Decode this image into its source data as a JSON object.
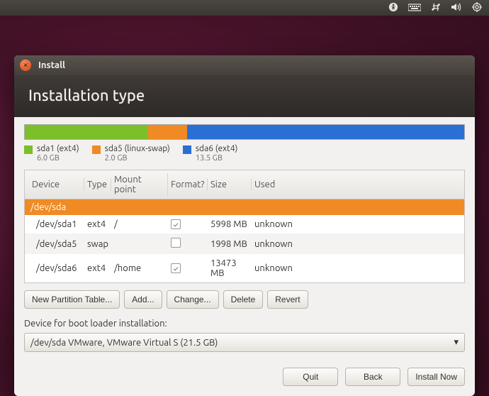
{
  "top_panel": {
    "icons": [
      "accessibility",
      "keyboard",
      "network",
      "sound",
      "power"
    ]
  },
  "window": {
    "title": "Install",
    "heading": "Installation type"
  },
  "partitions": {
    "legend": [
      {
        "label": "sda1 (ext4)",
        "size": "6.0 GB",
        "color": "#7bbf2a"
      },
      {
        "label": "sda5 (linux-swap)",
        "size": "2.0 GB",
        "color": "#f08a24"
      },
      {
        "label": "sda6 (ext4)",
        "size": "13.5 GB",
        "color": "#2a6fd4"
      }
    ],
    "segments_pct": [
      28,
      9,
      63
    ]
  },
  "table": {
    "headers": [
      "Device",
      "Type",
      "Mount point",
      "Format?",
      "Size",
      "Used"
    ],
    "disk_row": "/dev/sda",
    "rows": [
      {
        "device": "/dev/sda1",
        "type": "ext4",
        "mount": "/",
        "format": true,
        "size": "5998 MB",
        "used": "unknown"
      },
      {
        "device": "/dev/sda5",
        "type": "swap",
        "mount": "",
        "format": false,
        "size": "1998 MB",
        "used": "unknown"
      },
      {
        "device": "/dev/sda6",
        "type": "ext4",
        "mount": "/home",
        "format": true,
        "size": "13473 MB",
        "used": "unknown"
      }
    ]
  },
  "part_buttons": {
    "new_table": "New Partition Table...",
    "add": "Add...",
    "change": "Change...",
    "delete": "Delete",
    "revert": "Revert"
  },
  "bootloader": {
    "label": "Device for boot loader installation:",
    "value": "/dev/sda    VMware, VMware Virtual S (21.5 GB)"
  },
  "footer": {
    "quit": "Quit",
    "back": "Back",
    "install": "Install Now"
  }
}
